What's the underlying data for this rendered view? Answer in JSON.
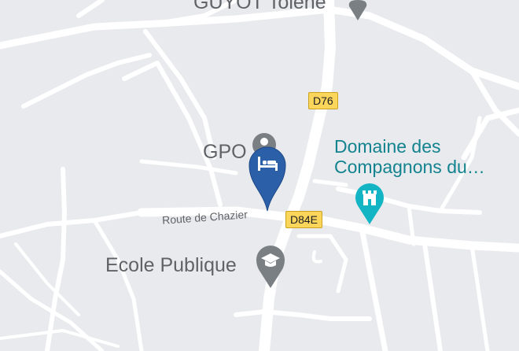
{
  "places": {
    "top_partial": "GUYOT Tolene",
    "gpo": "GPO",
    "domaine": "Domaine des Compagnons du…",
    "domaine_line1": "Domaine des",
    "domaine_line2": "Compagnons du…",
    "ecole": "Ecole Publique"
  },
  "roads": {
    "d76": "D76",
    "d84e": "D84E",
    "route_chazier": "Route de Chazier"
  },
  "markers": {
    "selected": "hotel-marker",
    "gpo_icon": "person-pin-icon",
    "domaine_icon": "castle-pin-icon",
    "ecole_icon": "school-pin-icon",
    "top_icon": "place-pin-icon"
  },
  "colors": {
    "background": "#e8eaed",
    "road": "#ffffff",
    "marker_blue": "#2b5fa8",
    "teal": "#13838f",
    "badge": "#fcd55b",
    "pin_gray": "#7a7f84"
  }
}
